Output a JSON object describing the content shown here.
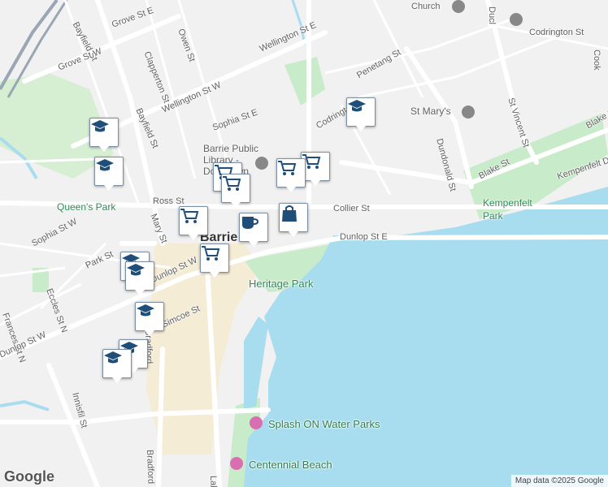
{
  "map": {
    "streets": [
      "Church",
      "Owen St",
      "Grove St E",
      "Bayfield St",
      "Grove St W",
      "Clapperton St",
      "Wellington St E",
      "Codrington St",
      "Penetang St",
      "Wellington St W",
      "Bayfield St",
      "Sophia St E",
      "Codrington",
      "Dundonald St",
      "St Vincent St",
      "Blake St",
      "Blake St",
      "Kempenfelt Dr",
      "Ross St",
      "Collier St",
      "Dunlop St E",
      "Mary St",
      "Sophia St W",
      "Park St",
      "Dunlop St W",
      "Eccles St N",
      "Frances St N",
      "Simcoe St",
      "Dunlop St W",
      "Innisfil St",
      "Bradford",
      "Bradford St",
      "Lake",
      "Ducl",
      "Cook"
    ],
    "places": {
      "library": "Barrie Public Library - Downtown",
      "queens_park": "Queen's Park",
      "kempenfelt_park": "Kempenfelt Park",
      "heritage_park": "Heritage Park",
      "splash": "Splash ON Water Parks",
      "centennial": "Centennial Beach",
      "st_marys": "St Mary's",
      "city": "Barrie"
    },
    "markers": [
      {
        "type": "school-icon"
      },
      {
        "type": "school-icon"
      },
      {
        "type": "school-icon"
      },
      {
        "type": "school-icon"
      },
      {
        "type": "school-icon"
      },
      {
        "type": "school-icon"
      },
      {
        "type": "school-icon"
      },
      {
        "type": "school-icon"
      },
      {
        "type": "shopping-cart-icon"
      },
      {
        "type": "shopping-cart-icon"
      },
      {
        "type": "shopping-cart-icon"
      },
      {
        "type": "shopping-cart-icon"
      },
      {
        "type": "shopping-cart-icon"
      },
      {
        "type": "shopping-cart-icon"
      },
      {
        "type": "coffee-icon"
      },
      {
        "type": "shopping-bag-icon"
      }
    ],
    "colors": {
      "water": "#a8dcef",
      "park": "#c8ebc9",
      "road": "#ffffff",
      "land": "#f1f1f1",
      "marker_icon": "#1f4e79"
    },
    "logo": "Google",
    "attribution": "Map data ©2025 Google"
  }
}
